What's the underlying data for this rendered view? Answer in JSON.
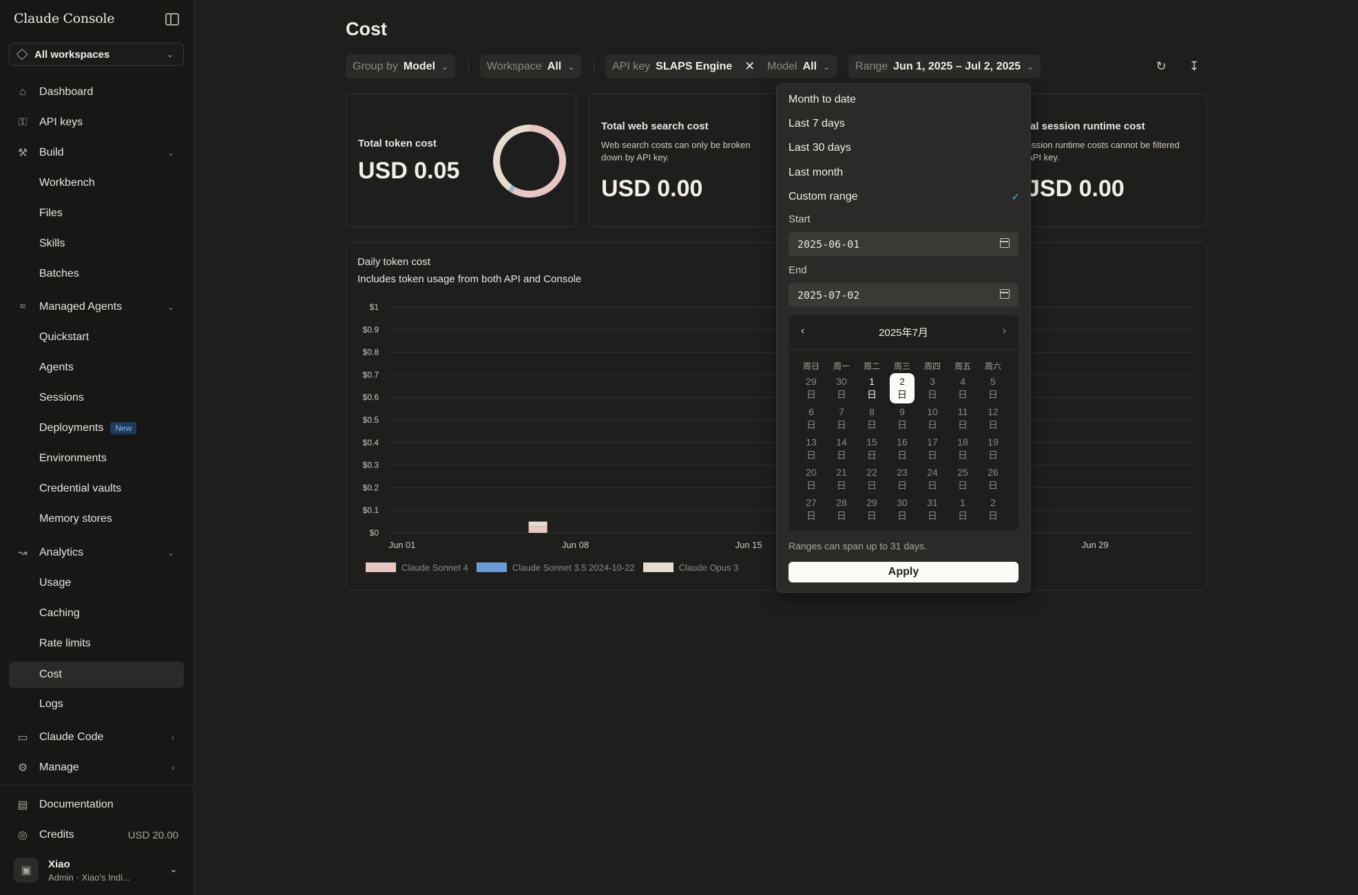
{
  "app": {
    "title": "Claude Console"
  },
  "sidebar": {
    "workspace_select": "All workspaces",
    "items": [
      {
        "label": "Dashboard",
        "icon": "home-icon"
      },
      {
        "label": "API keys",
        "icon": "key-icon"
      },
      {
        "label": "Build",
        "icon": "wrench-icon"
      },
      {
        "label": "Workbench"
      },
      {
        "label": "Files"
      },
      {
        "label": "Skills"
      },
      {
        "label": "Batches"
      },
      {
        "label": "Managed Agents",
        "icon": "agents-icon"
      },
      {
        "label": "Quickstart"
      },
      {
        "label": "Agents"
      },
      {
        "label": "Sessions"
      },
      {
        "label": "Deployments",
        "badge": "New"
      },
      {
        "label": "Environments"
      },
      {
        "label": "Credential vaults"
      },
      {
        "label": "Memory stores"
      },
      {
        "label": "Analytics",
        "icon": "chart-icon"
      },
      {
        "label": "Usage"
      },
      {
        "label": "Caching"
      },
      {
        "label": "Rate limits"
      },
      {
        "label": "Cost"
      },
      {
        "label": "Logs"
      },
      {
        "label": "Claude Code",
        "icon": "terminal-icon"
      },
      {
        "label": "Manage",
        "icon": "manage-icon"
      },
      {
        "label": "Documentation",
        "icon": "book-icon"
      },
      {
        "label": "Credits",
        "icon": "coin-icon",
        "amount": "USD 20.00"
      }
    ],
    "user": {
      "name": "Xiao",
      "role": "Admin",
      "sep": "·",
      "org": "Xiao's Indi..."
    }
  },
  "main": {
    "title": "Cost",
    "filters": {
      "group_by": {
        "key": "Group by",
        "value": "Model"
      },
      "workspace": {
        "key": "Workspace",
        "value": "All"
      },
      "api_key": {
        "key": "API key",
        "value": "SLAPS Engine"
      },
      "model": {
        "key": "Model",
        "value": "All"
      },
      "range": {
        "key": "Range",
        "value": "Jun 1, 2025 – Jul 2, 2025"
      }
    },
    "cards": {
      "token": {
        "title": "Total token cost",
        "value": "USD 0.05"
      },
      "web_search": {
        "title": "Total web search cost",
        "desc1": "Web search costs can only be broken",
        "desc2": "down by API key.",
        "value": "USD 0.00"
      },
      "session": {
        "title": "tal session runtime cost",
        "desc1": "ession runtime costs cannot be filtered",
        "desc2": "API key.",
        "value": "JSD 0.00"
      }
    },
    "daily": {
      "title": "Daily token cost",
      "subtitle": "Includes token usage from both API and Console"
    }
  },
  "chart_data": {
    "type": "bar",
    "title": "Daily token cost",
    "subtitle": "Includes token usage from both API and Console",
    "y_ticks": [
      "$1",
      "$0.9",
      "$0.8",
      "$0.7",
      "$0.6",
      "$0.5",
      "$0.4",
      "$0.3",
      "$0.2",
      "$0.1",
      "$0"
    ],
    "ylim": [
      0,
      1
    ],
    "x_ticks": [
      "Jun 01",
      "Jun 08",
      "Jun 15",
      "Jun 29"
    ],
    "categories": [
      "Jun 06"
    ],
    "series": [
      {
        "name": "Claude Sonnet 4",
        "color": "#e8c6c4",
        "values": [
          0.03
        ]
      },
      {
        "name": "Claude Sonnet 3.5 2024-10-22",
        "color": "#6b9bd6",
        "values": [
          0.0
        ]
      },
      {
        "name": "Claude Opus 3",
        "color": "#e6ddd0",
        "values": [
          0.02
        ]
      }
    ],
    "grid": true,
    "legend": "bottom-left"
  },
  "donut": {
    "series": [
      {
        "name": "Claude Sonnet 4",
        "fraction": 0.58,
        "color": "#e8c6c4"
      },
      {
        "name": "Claude Sonnet 3.5 2024-10-22",
        "fraction": 0.02,
        "color": "#9fb6d0"
      },
      {
        "name": "Claude Opus 3",
        "fraction": 0.4,
        "color": "#e6ddd0"
      }
    ]
  },
  "range_dropdown": {
    "options": [
      "Month to date",
      "Last 7 days",
      "Last 30 days",
      "Last month",
      "Custom range"
    ],
    "selected": "Custom range",
    "start_label": "Start",
    "start_value": "2025-06-01",
    "end_label": "End",
    "end_value": "2025-07-02",
    "calendar": {
      "month_label": "2025年7月",
      "weekdays": [
        "周日",
        "周一",
        "周二",
        "周三",
        "周四",
        "周五",
        "周六"
      ],
      "day_suffix": "日",
      "days": [
        {
          "d": "29",
          "in": false
        },
        {
          "d": "30",
          "in": false
        },
        {
          "d": "1",
          "in": true
        },
        {
          "d": "2",
          "in": true,
          "sel": true
        },
        {
          "d": "3",
          "in": false
        },
        {
          "d": "4",
          "in": false
        },
        {
          "d": "5",
          "in": false
        },
        {
          "d": "6",
          "in": false
        },
        {
          "d": "7",
          "in": false
        },
        {
          "d": "8",
          "in": false
        },
        {
          "d": "9",
          "in": false
        },
        {
          "d": "10",
          "in": false
        },
        {
          "d": "11",
          "in": false
        },
        {
          "d": "12",
          "in": false
        },
        {
          "d": "13",
          "in": false
        },
        {
          "d": "14",
          "in": false
        },
        {
          "d": "15",
          "in": false
        },
        {
          "d": "16",
          "in": false
        },
        {
          "d": "17",
          "in": false
        },
        {
          "d": "18",
          "in": false
        },
        {
          "d": "19",
          "in": false
        },
        {
          "d": "20",
          "in": false
        },
        {
          "d": "21",
          "in": false
        },
        {
          "d": "22",
          "in": false
        },
        {
          "d": "23",
          "in": false
        },
        {
          "d": "24",
          "in": false
        },
        {
          "d": "25",
          "in": false
        },
        {
          "d": "26",
          "in": false
        },
        {
          "d": "27",
          "in": false
        },
        {
          "d": "28",
          "in": false
        },
        {
          "d": "29",
          "in": false
        },
        {
          "d": "30",
          "in": false
        },
        {
          "d": "31",
          "in": false
        },
        {
          "d": "1",
          "in": false
        },
        {
          "d": "2",
          "in": false
        }
      ]
    },
    "hint": "Ranges can span up to 31 days.",
    "apply": "Apply"
  }
}
